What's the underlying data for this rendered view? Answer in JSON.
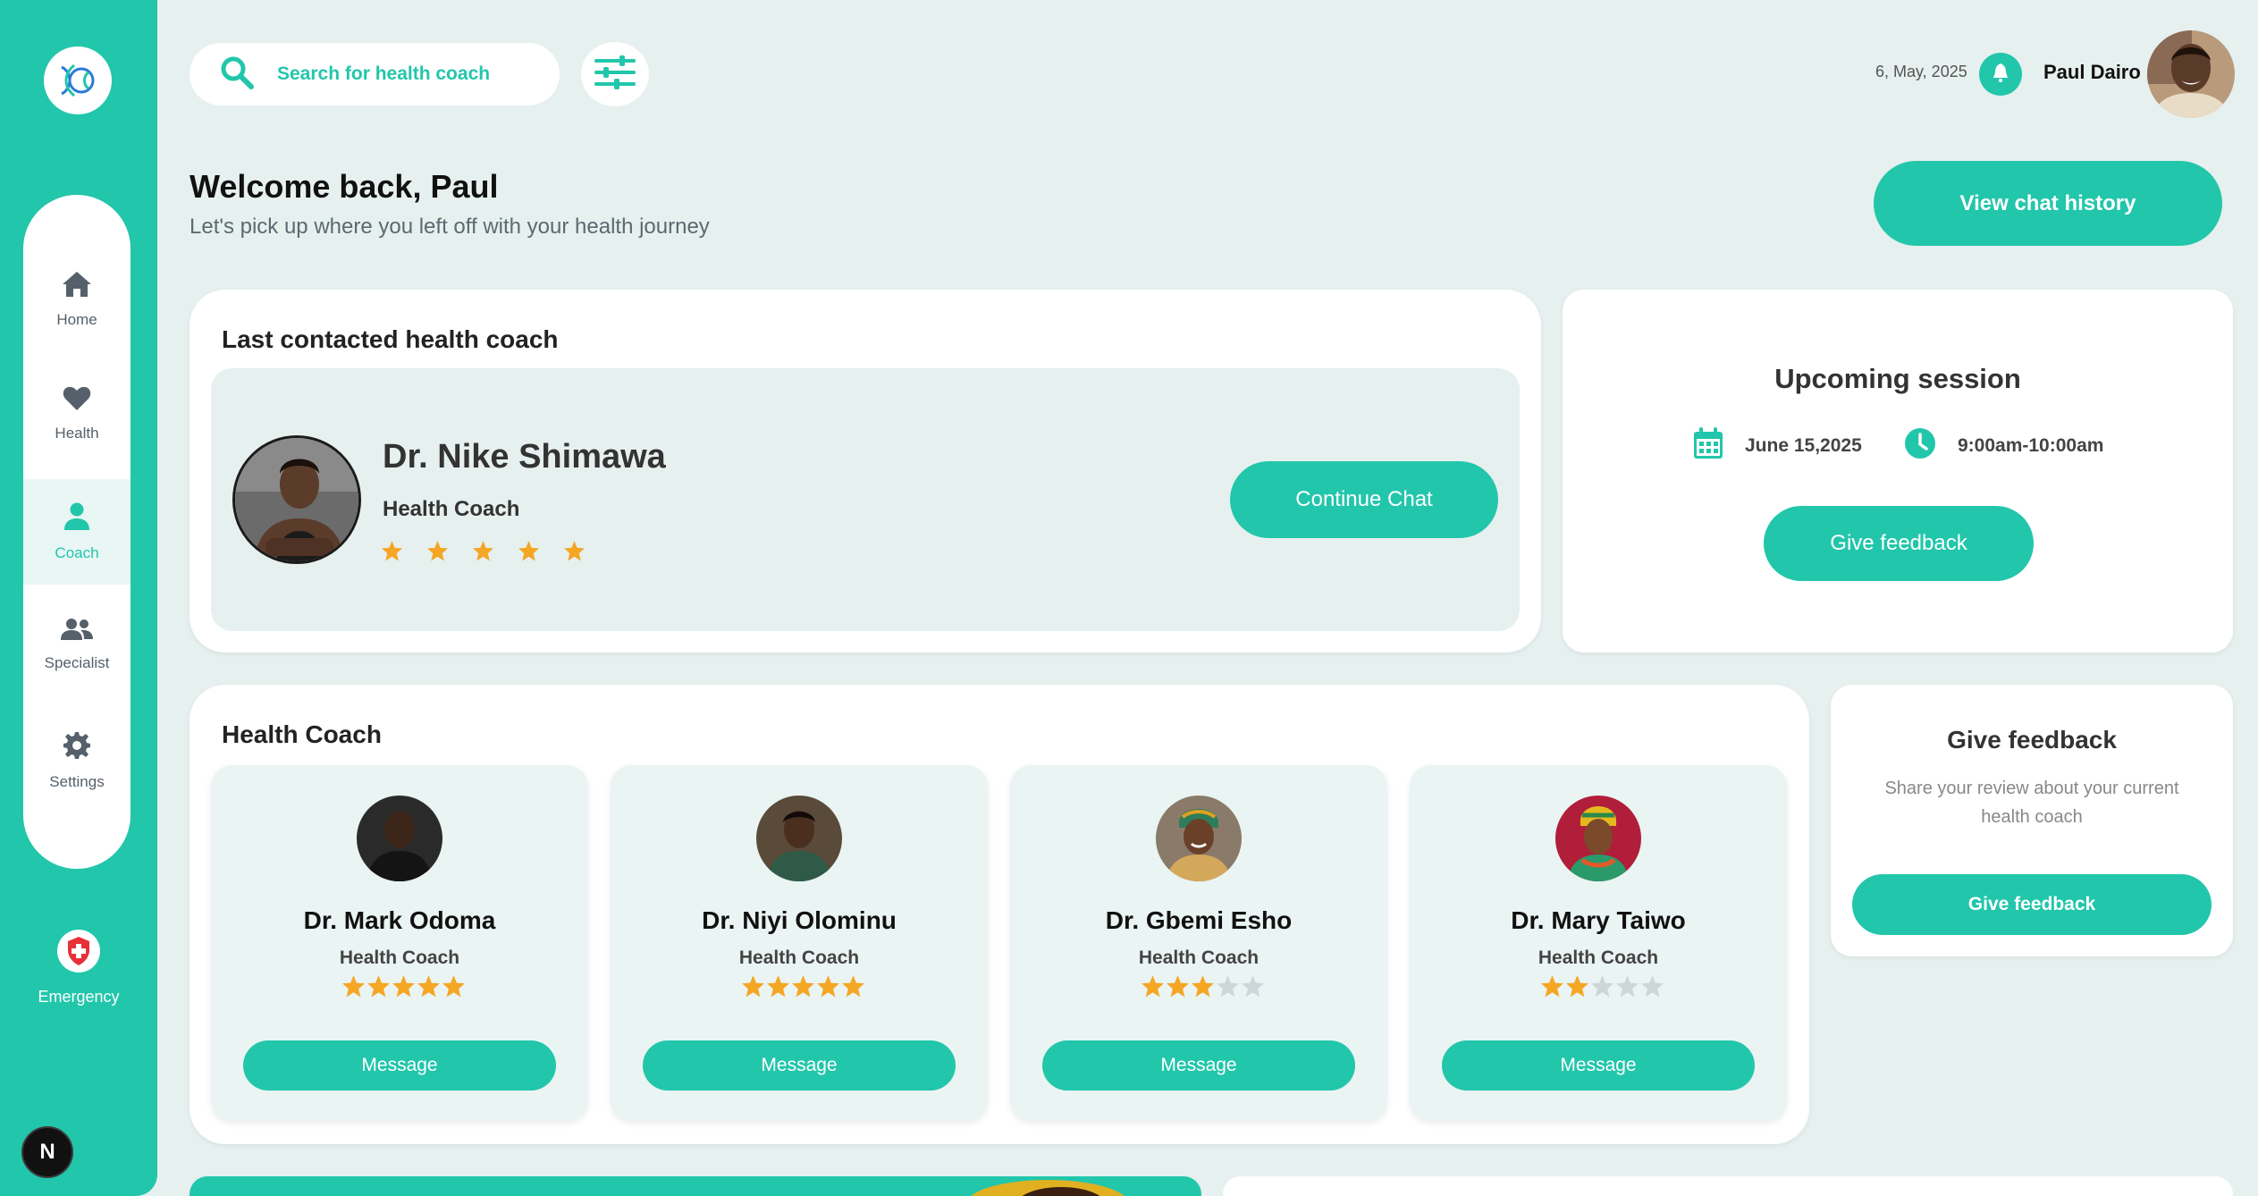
{
  "sidebar": {
    "items": [
      {
        "label": "Home",
        "icon": "home-icon"
      },
      {
        "label": "Health",
        "icon": "heart-icon"
      },
      {
        "label": "Coach",
        "icon": "person-icon",
        "active": true
      },
      {
        "label": "Specialist",
        "icon": "people-icon"
      },
      {
        "label": "Settings",
        "icon": "gear-icon"
      }
    ],
    "emergency_label": "Emergency",
    "badge_letter": "N"
  },
  "topbar": {
    "search_placeholder": "Search for health coach",
    "date": "6, May, 2025",
    "user_name": "Paul Dairo"
  },
  "welcome": {
    "title": "Welcome back, Paul",
    "subtitle": "Let's pick up where you left off with your health journey",
    "history_button": "View chat history"
  },
  "last_contacted": {
    "title": "Last contacted health coach",
    "name": "Dr. Nike Shimawa",
    "role": "Health Coach",
    "rating": 5,
    "button": "Continue Chat"
  },
  "upcoming": {
    "title": "Upcoming session",
    "date": "June 15,2025",
    "time": "9:00am-10:00am",
    "button": "Give feedback"
  },
  "health_coach": {
    "title": "Health Coach",
    "coaches": [
      {
        "name": "Dr. Mark Odoma",
        "role": "Health Coach",
        "rating": 5,
        "button": "Message"
      },
      {
        "name": "Dr. Niyi Olominu",
        "role": "Health Coach",
        "rating": 5,
        "button": "Message"
      },
      {
        "name": "Dr. Gbemi Esho",
        "role": "Health Coach",
        "rating": 3,
        "button": "Message"
      },
      {
        "name": "Dr. Mary Taiwo",
        "role": "Health Coach",
        "rating": 2,
        "button": "Message"
      }
    ]
  },
  "feedback": {
    "title": "Give feedback",
    "description": "Share your review about your current health coach",
    "button": "Give feedback"
  },
  "colors": {
    "accent": "#22c6ab",
    "background": "#e6f0ef",
    "star": "#f5a623",
    "star_empty": "#cfd6d9",
    "emergency": "#e8303a"
  }
}
